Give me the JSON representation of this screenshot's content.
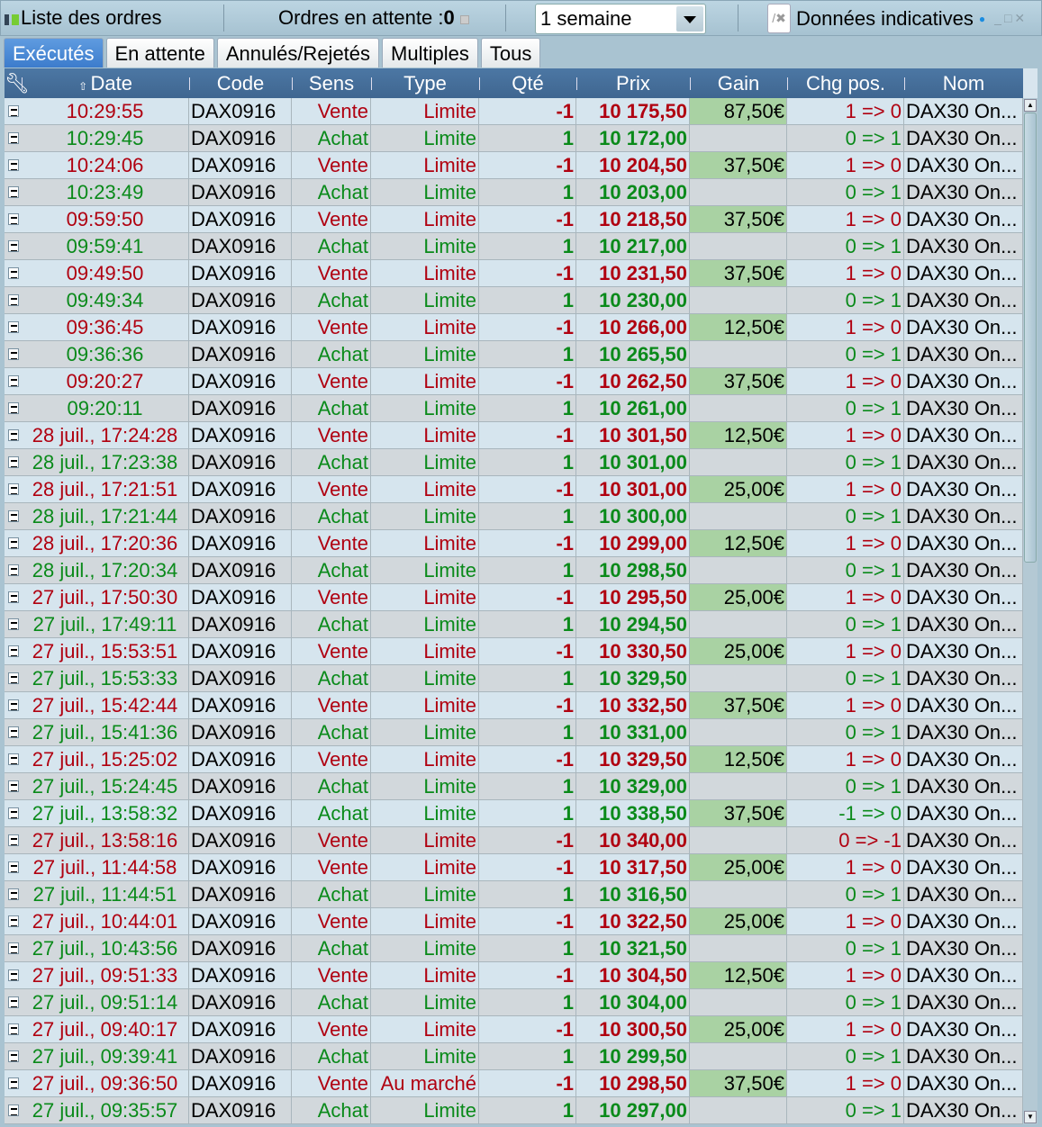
{
  "topbar": {
    "title": "Liste des ordres",
    "pending_label": "Ordres en attente :",
    "pending_count": "0",
    "period": "1 semaine",
    "indicative": "Données indicatives"
  },
  "tabs": [
    "Exécutés",
    "En attente",
    "Annulés/Rejetés",
    "Multiples",
    "Tous"
  ],
  "columns": [
    "Date",
    "Code",
    "Sens",
    "Type",
    "Qté",
    "Prix",
    "Gain",
    "Chg pos.",
    "Nom"
  ],
  "colors": {
    "sell": "#b00010",
    "buy": "#0a8a1a",
    "gain_bg": "#a9d2a3",
    "header": "#466f9a"
  },
  "rows": [
    [
      "10:29:55",
      "DAX0916",
      "Vente",
      "Limite",
      "-1",
      "10 175,50",
      "87,50€",
      "1 => 0",
      "DAX30 On..."
    ],
    [
      "10:29:45",
      "DAX0916",
      "Achat",
      "Limite",
      "1",
      "10 172,00",
      "",
      "0 => 1",
      "DAX30 On..."
    ],
    [
      "10:24:06",
      "DAX0916",
      "Vente",
      "Limite",
      "-1",
      "10 204,50",
      "37,50€",
      "1 => 0",
      "DAX30 On..."
    ],
    [
      "10:23:49",
      "DAX0916",
      "Achat",
      "Limite",
      "1",
      "10 203,00",
      "",
      "0 => 1",
      "DAX30 On..."
    ],
    [
      "09:59:50",
      "DAX0916",
      "Vente",
      "Limite",
      "-1",
      "10 218,50",
      "37,50€",
      "1 => 0",
      "DAX30 On..."
    ],
    [
      "09:59:41",
      "DAX0916",
      "Achat",
      "Limite",
      "1",
      "10 217,00",
      "",
      "0 => 1",
      "DAX30 On..."
    ],
    [
      "09:49:50",
      "DAX0916",
      "Vente",
      "Limite",
      "-1",
      "10 231,50",
      "37,50€",
      "1 => 0",
      "DAX30 On..."
    ],
    [
      "09:49:34",
      "DAX0916",
      "Achat",
      "Limite",
      "1",
      "10 230,00",
      "",
      "0 => 1",
      "DAX30 On..."
    ],
    [
      "09:36:45",
      "DAX0916",
      "Vente",
      "Limite",
      "-1",
      "10 266,00",
      "12,50€",
      "1 => 0",
      "DAX30 On..."
    ],
    [
      "09:36:36",
      "DAX0916",
      "Achat",
      "Limite",
      "1",
      "10 265,50",
      "",
      "0 => 1",
      "DAX30 On..."
    ],
    [
      "09:20:27",
      "DAX0916",
      "Vente",
      "Limite",
      "-1",
      "10 262,50",
      "37,50€",
      "1 => 0",
      "DAX30 On..."
    ],
    [
      "09:20:11",
      "DAX0916",
      "Achat",
      "Limite",
      "1",
      "10 261,00",
      "",
      "0 => 1",
      "DAX30 On..."
    ],
    [
      "28 juil., 17:24:28",
      "DAX0916",
      "Vente",
      "Limite",
      "-1",
      "10 301,50",
      "12,50€",
      "1 => 0",
      "DAX30 On..."
    ],
    [
      "28 juil., 17:23:38",
      "DAX0916",
      "Achat",
      "Limite",
      "1",
      "10 301,00",
      "",
      "0 => 1",
      "DAX30 On..."
    ],
    [
      "28 juil., 17:21:51",
      "DAX0916",
      "Vente",
      "Limite",
      "-1",
      "10 301,00",
      "25,00€",
      "1 => 0",
      "DAX30 On..."
    ],
    [
      "28 juil., 17:21:44",
      "DAX0916",
      "Achat",
      "Limite",
      "1",
      "10 300,00",
      "",
      "0 => 1",
      "DAX30 On..."
    ],
    [
      "28 juil., 17:20:36",
      "DAX0916",
      "Vente",
      "Limite",
      "-1",
      "10 299,00",
      "12,50€",
      "1 => 0",
      "DAX30 On..."
    ],
    [
      "28 juil., 17:20:34",
      "DAX0916",
      "Achat",
      "Limite",
      "1",
      "10 298,50",
      "",
      "0 => 1",
      "DAX30 On..."
    ],
    [
      "27 juil., 17:50:30",
      "DAX0916",
      "Vente",
      "Limite",
      "-1",
      "10 295,50",
      "25,00€",
      "1 => 0",
      "DAX30 On..."
    ],
    [
      "27 juil., 17:49:11",
      "DAX0916",
      "Achat",
      "Limite",
      "1",
      "10 294,50",
      "",
      "0 => 1",
      "DAX30 On..."
    ],
    [
      "27 juil., 15:53:51",
      "DAX0916",
      "Vente",
      "Limite",
      "-1",
      "10 330,50",
      "25,00€",
      "1 => 0",
      "DAX30 On..."
    ],
    [
      "27 juil., 15:53:33",
      "DAX0916",
      "Achat",
      "Limite",
      "1",
      "10 329,50",
      "",
      "0 => 1",
      "DAX30 On..."
    ],
    [
      "27 juil., 15:42:44",
      "DAX0916",
      "Vente",
      "Limite",
      "-1",
      "10 332,50",
      "37,50€",
      "1 => 0",
      "DAX30 On..."
    ],
    [
      "27 juil., 15:41:36",
      "DAX0916",
      "Achat",
      "Limite",
      "1",
      "10 331,00",
      "",
      "0 => 1",
      "DAX30 On..."
    ],
    [
      "27 juil., 15:25:02",
      "DAX0916",
      "Vente",
      "Limite",
      "-1",
      "10 329,50",
      "12,50€",
      "1 => 0",
      "DAX30 On..."
    ],
    [
      "27 juil., 15:24:45",
      "DAX0916",
      "Achat",
      "Limite",
      "1",
      "10 329,00",
      "",
      "0 => 1",
      "DAX30 On..."
    ],
    [
      "27 juil., 13:58:32",
      "DAX0916",
      "Achat",
      "Limite",
      "1",
      "10 338,50",
      "37,50€",
      "-1 => 0",
      "DAX30 On..."
    ],
    [
      "27 juil., 13:58:16",
      "DAX0916",
      "Vente",
      "Limite",
      "-1",
      "10 340,00",
      "",
      "0 => -1",
      "DAX30 On..."
    ],
    [
      "27 juil., 11:44:58",
      "DAX0916",
      "Vente",
      "Limite",
      "-1",
      "10 317,50",
      "25,00€",
      "1 => 0",
      "DAX30 On..."
    ],
    [
      "27 juil., 11:44:51",
      "DAX0916",
      "Achat",
      "Limite",
      "1",
      "10 316,50",
      "",
      "0 => 1",
      "DAX30 On..."
    ],
    [
      "27 juil., 10:44:01",
      "DAX0916",
      "Vente",
      "Limite",
      "-1",
      "10 322,50",
      "25,00€",
      "1 => 0",
      "DAX30 On..."
    ],
    [
      "27 juil., 10:43:56",
      "DAX0916",
      "Achat",
      "Limite",
      "1",
      "10 321,50",
      "",
      "0 => 1",
      "DAX30 On..."
    ],
    [
      "27 juil., 09:51:33",
      "DAX0916",
      "Vente",
      "Limite",
      "-1",
      "10 304,50",
      "12,50€",
      "1 => 0",
      "DAX30 On..."
    ],
    [
      "27 juil., 09:51:14",
      "DAX0916",
      "Achat",
      "Limite",
      "1",
      "10 304,00",
      "",
      "0 => 1",
      "DAX30 On..."
    ],
    [
      "27 juil., 09:40:17",
      "DAX0916",
      "Vente",
      "Limite",
      "-1",
      "10 300,50",
      "25,00€",
      "1 => 0",
      "DAX30 On..."
    ],
    [
      "27 juil., 09:39:41",
      "DAX0916",
      "Achat",
      "Limite",
      "1",
      "10 299,50",
      "",
      "0 => 1",
      "DAX30 On..."
    ],
    [
      "27 juil., 09:36:50",
      "DAX0916",
      "Vente",
      "Au marché",
      "-1",
      "10 298,50",
      "37,50€",
      "1 => 0",
      "DAX30 On..."
    ],
    [
      "27 juil., 09:35:57",
      "DAX0916",
      "Achat",
      "Limite",
      "1",
      "10 297,00",
      "",
      "0 => 1",
      "DAX30 On..."
    ]
  ]
}
